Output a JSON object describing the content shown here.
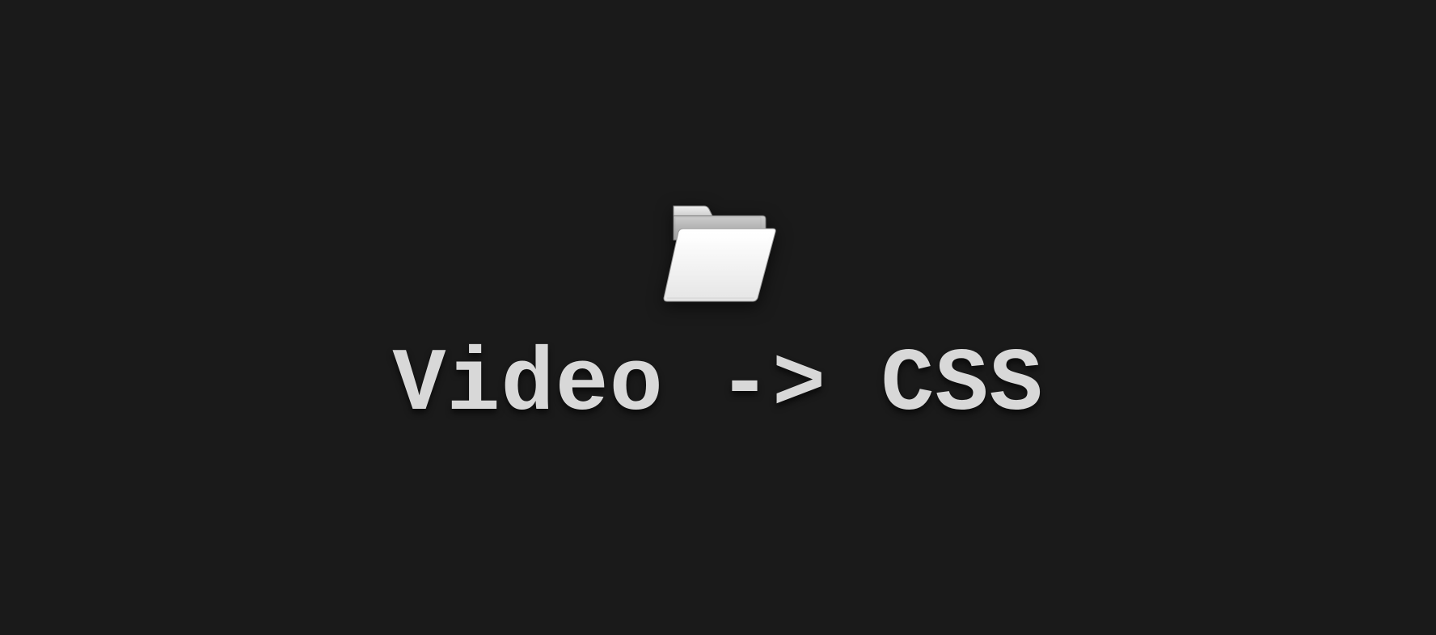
{
  "main": {
    "icon": "open-folder-icon",
    "title": "Video -> CSS"
  }
}
